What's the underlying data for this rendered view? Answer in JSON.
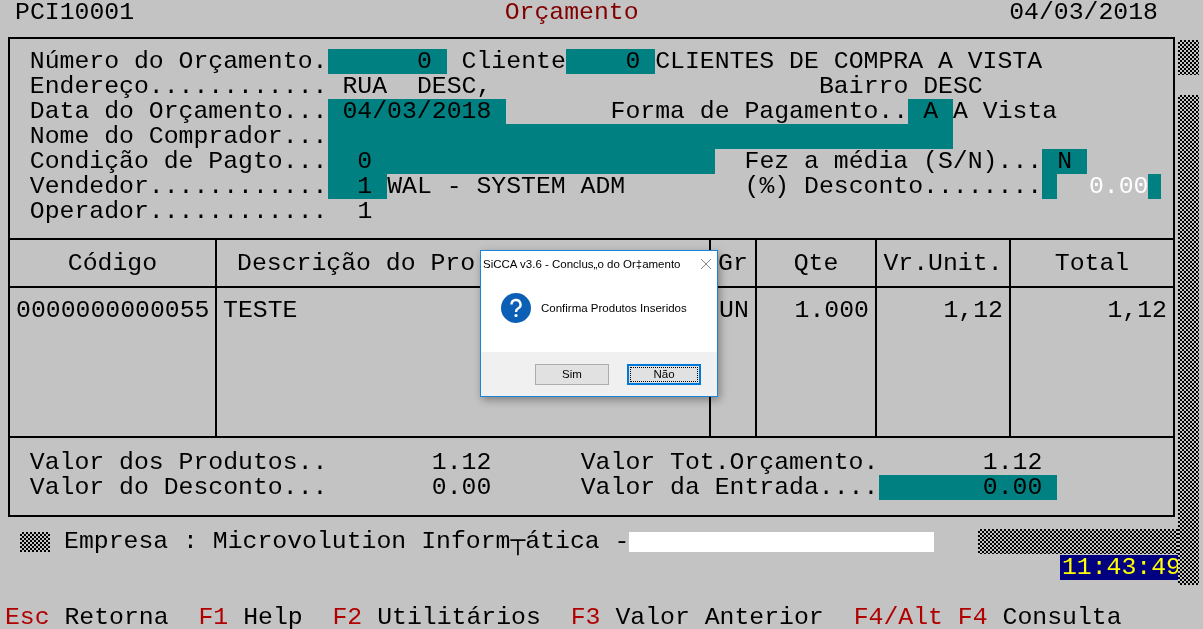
{
  "header": {
    "program_id": "PCI10001",
    "title": "Orçamento",
    "date": "04/03/2018"
  },
  "form_rows": [
    {
      "items": [
        {
          "kind": "label",
          "text": "Número do Orçamento."
        },
        {
          "kind": "field",
          "value": "0"
        },
        {
          "kind": "label",
          "text": "Cliente"
        },
        {
          "kind": "field",
          "value": "0"
        },
        {
          "kind": "text",
          "text": "CLIENTES DE COMPRA A VISTA"
        }
      ]
    },
    {
      "items": [
        {
          "kind": "label",
          "text": "Endereço............"
        },
        {
          "kind": "text",
          "text": "RUA  DESC,"
        },
        {
          "kind": "text",
          "text": "Bairro DESC"
        }
      ]
    },
    {
      "items": [
        {
          "kind": "label",
          "text": "Data do Orçamento..."
        },
        {
          "kind": "field",
          "value": "04/03/2018"
        },
        {
          "kind": "label",
          "text": "Forma de Pagamento.."
        },
        {
          "kind": "field",
          "value": "A"
        },
        {
          "kind": "text",
          "text": "A Vista"
        }
      ]
    },
    {
      "items": [
        {
          "kind": "label",
          "text": "Nome do Comprador..."
        },
        {
          "kind": "field"
        }
      ]
    },
    {
      "items": [
        {
          "kind": "label",
          "text": "Condição de Pagto..."
        },
        {
          "kind": "field",
          "value": "0"
        },
        {
          "kind": "label",
          "text": "Fez a média (S/N)..."
        },
        {
          "kind": "field",
          "value": "N"
        }
      ]
    },
    {
      "items": [
        {
          "kind": "label",
          "text": "Vendedor............"
        },
        {
          "kind": "field",
          "value": "1"
        },
        {
          "kind": "text",
          "text": "WAL - SYSTEM ADM"
        },
        {
          "kind": "label",
          "text": "(%) Desconto........"
        },
        {
          "kind": "input",
          "value": "0.00"
        }
      ]
    },
    {
      "items": [
        {
          "kind": "label",
          "text": "Operador............"
        },
        {
          "kind": "text",
          "text": "1"
        }
      ]
    }
  ],
  "table": {
    "columns": [
      "Código",
      "Descrição do Pro",
      "Gr",
      "Qte",
      "Vr.Unit.",
      "Total"
    ],
    "rows": [
      [
        "0000000000055",
        "TESTE",
        "UN",
        "1.000",
        "1,12",
        "1,12"
      ]
    ]
  },
  "totals": [
    {
      "label": "Valor dos Produtos..",
      "value": "1.12",
      "label2": "Valor Tot.Orçamento.",
      "value2": "1.12",
      "field2": false
    },
    {
      "label": "Valor do Desconto...",
      "value": "0.00",
      "label2": "Valor da Entrada....",
      "value2": "0.00",
      "field2": true
    }
  ],
  "company": "Empresa : Microvolution Inform┬ática -",
  "clock": "11:43:49",
  "function_keys": [
    {
      "key": "Esc",
      "label": "Retorna"
    },
    {
      "key": "F1",
      "label": "Help"
    },
    {
      "key": "F2",
      "label": "Utilitários"
    },
    {
      "key": "F3",
      "label": "Valor Anterior"
    },
    {
      "key": "F4/Alt F4",
      "label": "Consulta"
    }
  ],
  "dialog": {
    "title": "SiCCA v3.6 - Conclus„o do Or‡amento",
    "message": "Confirma Produtos Inseridos",
    "buttons": [
      {
        "label": "Sim",
        "focused": false
      },
      {
        "label": "Não",
        "focused": true
      }
    ]
  }
}
